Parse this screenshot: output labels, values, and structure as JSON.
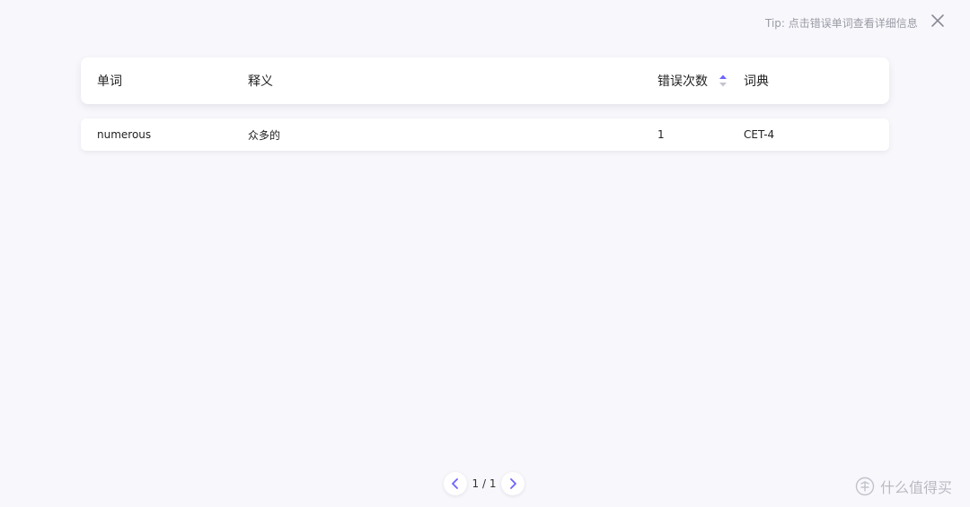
{
  "tip": "Tip: 点击错误单词查看详细信息",
  "table": {
    "headers": {
      "word": "单词",
      "definition": "释义",
      "error_count": "错误次数",
      "dictionary": "词典"
    },
    "rows": [
      {
        "word": "numerous",
        "definition": "众多的",
        "error_count": "1",
        "dictionary": "CET-4"
      }
    ]
  },
  "pagination": {
    "label": "1 / 1"
  },
  "watermark": {
    "text": "什么值得买"
  },
  "colors": {
    "background": "#f8f8fc",
    "accent": "#6c63ff",
    "muted": "#9a9aa6"
  },
  "icons": {
    "close": "close-icon",
    "sort": "sort-icon",
    "prev": "chevron-left-icon",
    "next": "chevron-right-icon"
  }
}
